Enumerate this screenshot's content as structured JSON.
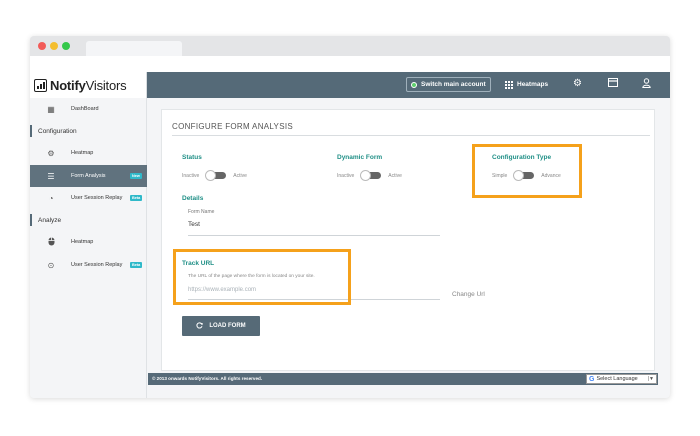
{
  "header": {
    "logo_notify": "Notify",
    "logo_visitors": "Visitors",
    "switch_account_label": "Switch main account",
    "heatmaps_label": "Heatmaps",
    "icons": [
      "gear-icon",
      "card-icon",
      "user-icon"
    ]
  },
  "sidebar": {
    "dashboard": "DashBoard",
    "section_configuration": "Configuration",
    "config_heatmap": "Heatmap",
    "form_analysis": "Form Analysis",
    "form_analysis_badge": "New",
    "user_session_replay": "User Session Replay",
    "user_session_replay_badge": "Beta",
    "section_analyze": "Analyze",
    "analyze_heatmap": "Heatmap",
    "analyze_user_session_replay": "User Session Replay",
    "analyze_user_session_replay_badge": "Beta"
  },
  "main": {
    "page_title": "CONFIGURE  FORM  ANALYSIS",
    "status": {
      "title": "Status",
      "off_label": "Inactive",
      "on_label": "Active"
    },
    "dynamic_form": {
      "title": "Dynamic Form",
      "off_label": "Inactive",
      "on_label": "Active"
    },
    "configuration_type": {
      "title": "Configuration Type",
      "off_label": "Simple",
      "on_label": "Advance"
    },
    "details": {
      "title": "Details",
      "form_name_label": "Form Name",
      "form_name_value": "Test"
    },
    "track_url": {
      "title": "Track URL",
      "hint": "The URL of the page where the form is located on your site.",
      "placeholder": "https://www.example.com",
      "change_url": "Change Url"
    },
    "load_form_label": "LOAD FORM"
  },
  "footer": {
    "copyright": "© 2013 onwards NotifyVisitors. All rights reserved.",
    "language_select": "Select Language"
  },
  "colors": {
    "topbar": "#556a78",
    "accent_teal": "#1f8f86",
    "highlight_orange": "#f5a11b",
    "active_sidebar": "#60727e"
  }
}
